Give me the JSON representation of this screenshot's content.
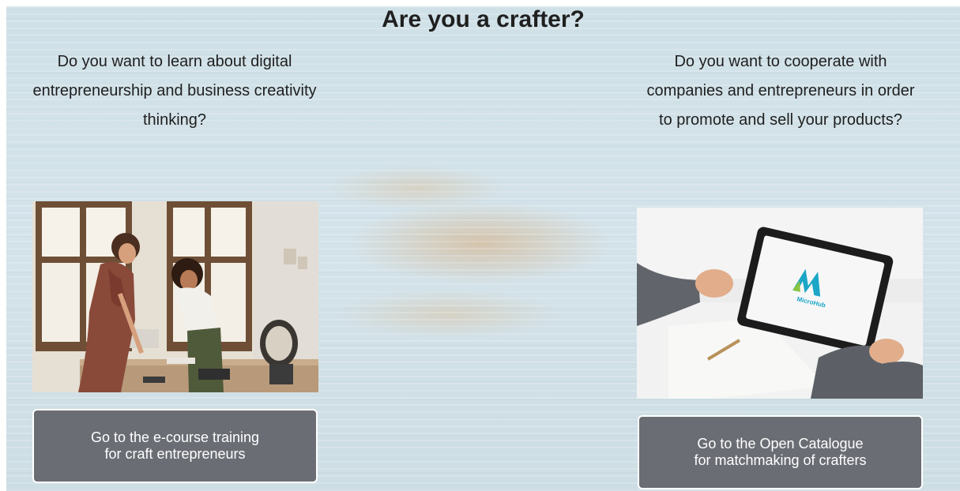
{
  "header": {
    "title": "Are you a crafter?"
  },
  "left": {
    "question": "Do you want to learn about digital entrepreneurship and business creativity thinking?",
    "image_label": "two-women-crafting-photo",
    "button_line1": "Go to the e-course training",
    "button_line2": "for craft entrepreneurs"
  },
  "right": {
    "question": "Do you want to cooperate with companies and entrepreneurs in order to promote and sell your products?",
    "image_label": "tablet-with-logo-photo",
    "logo_text": "MicroHub",
    "button_line1": "Go to the Open Catalogue",
    "button_line2": "for matchmaking of crafters"
  },
  "colors": {
    "button_bg": "#6a6d74",
    "button_border": "#ffffff",
    "title": "#1f1f1f",
    "logo_accent": "#1aa6c6"
  }
}
